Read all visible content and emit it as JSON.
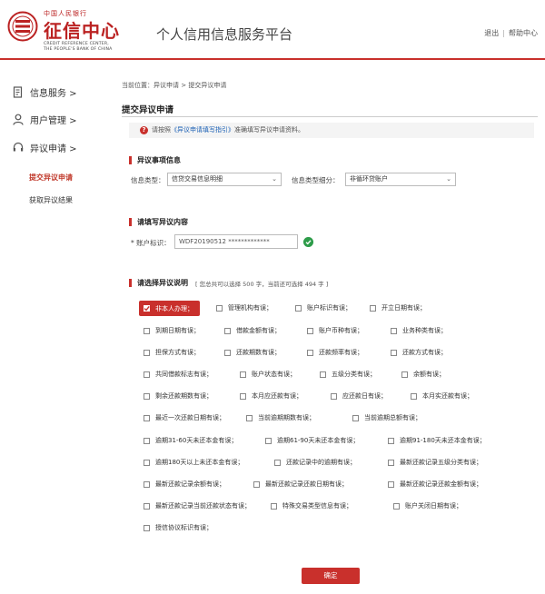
{
  "header": {
    "logo_top": "中国人民银行",
    "logo_main": "征信中心",
    "logo_en1": "CREDIT REFERENCE CENTER,",
    "logo_en2": "THE PEOPLE'S BANK OF CHINA",
    "site_title": "个人信用信息服务平台",
    "logout": "退出",
    "separator": "|",
    "help": "帮助中心"
  },
  "sidebar": {
    "items": [
      {
        "label": "信息服务 >",
        "icon": "document-icon"
      },
      {
        "label": "用户管理 >",
        "icon": "user-icon"
      },
      {
        "label": "异议申请 >",
        "icon": "headset-icon"
      }
    ],
    "sub_items": [
      {
        "label": "提交异议申请",
        "active": true
      },
      {
        "label": "获取异议结果",
        "active": false
      }
    ]
  },
  "main": {
    "breadcrumb": "当前位置：异议申请 > 提交异议申请",
    "page_title": "提交异议申请",
    "notice": {
      "prefix": "请按照",
      "link": "《异议申请填写指引》",
      "suffix": "准确填写异议申请资料。"
    },
    "section1": {
      "title": "异议事项信息",
      "info_type_label": "信息类型：",
      "info_type_value": "信贷交易信息明细",
      "sub_type_label": "信息类型细分：",
      "sub_type_value": "非循环贷账户"
    },
    "section2": {
      "title": "请填写异议内容",
      "account_label": "* 账户标识：",
      "account_value": "WDF20190512 *************"
    },
    "section3": {
      "title": "请选择异议说明",
      "count_text": "[ 您总共可以选择 500 字，当前还可选择 494 字 ]",
      "options": [
        [
          "非本人办理；",
          "管理机构有误；",
          "账户标识有误；",
          "开立日期有误；"
        ],
        [
          "到期日期有误；",
          "借款金额有误；",
          "账户币种有误；",
          "业务种类有误；"
        ],
        [
          "担保方式有误；",
          "还款期数有误；",
          "还款频率有误；",
          "还款方式有误；"
        ],
        [
          "共同借款标志有误；",
          "账户状态有误；",
          "五级分类有误；",
          "余额有误；"
        ],
        [
          "剩余还款期数有误；",
          "本月应还款有误；",
          "应还款日有误；",
          "本月实还款有误；"
        ],
        [
          "最近一次还款日期有误；",
          "当前逾期期数有误；",
          "当前逾期总额有误；"
        ],
        [
          "逾期31-60天未还本金有误；",
          "逾期61-90天未还本金有误；",
          "逾期91-180天未还本金有误；"
        ],
        [
          "逾期180天以上未还本金有误；",
          "还款记录中的逾期有误；",
          "最新还款记录五级分类有误；"
        ],
        [
          "最新还款记录余额有误；",
          "最新还款记录还款日期有误；",
          "最新还款记录还款金额有误；"
        ],
        [
          "最新还款记录当前还款状态有误；",
          "特殊交易类型信息有误；",
          "账户关闭日期有误；"
        ],
        [
          "授信协议标识有误；"
        ]
      ]
    },
    "submit_label": "确定"
  },
  "colors": {
    "accent": "#c9302c",
    "link": "#1a5fb4",
    "success": "#2e9c4a"
  }
}
